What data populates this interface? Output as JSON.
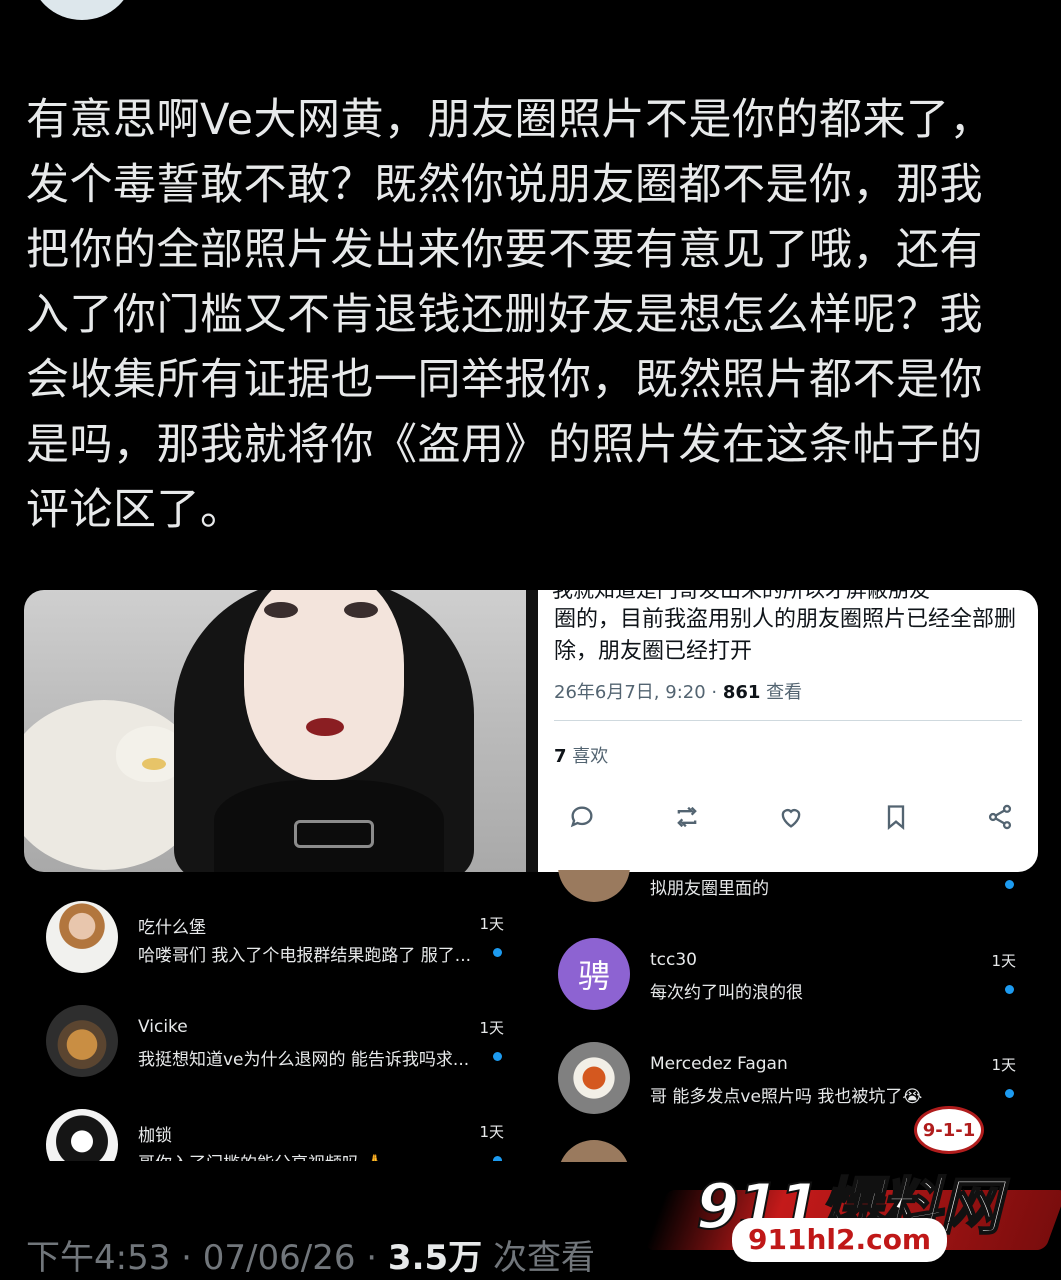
{
  "post": {
    "text": "有意思啊Ve大网黄，朋友圈照片不是你的都来了，发个毒誓敢不敢？既然你说朋友圈都不是你，那我把你的全部照片发出来你要不要有意见了哦，还有入了你门槛又不肯退钱还删好友是想怎么样呢？我会收集所有证据也一同举报你，既然照片都不是你是吗，那我就将你《盗用》的照片发在这条帖子的评论区了。",
    "time": "下午4:53 · 07/06/26 · ",
    "views_count": "3.5万",
    "views_label": " 次查看"
  },
  "embedded_tweet": {
    "cut_line": "我就知道是门哥发出来的所以才屏蔽朋友",
    "body": "圈的，目前我盗用别人的朋友圈照片已经全部删除，朋友圈已经打开",
    "date": "26年6月7日, 9:20 · ",
    "views_count": "861",
    "views_label": " 查看",
    "likes_count": "7",
    "likes_label": " 喜欢",
    "icons": [
      "reply-icon",
      "retweet-icon",
      "like-icon",
      "bookmark-icon",
      "share-icon"
    ]
  },
  "comments_left": [
    {
      "name": "吃什么堡",
      "text": "哈喽哥们 我入了个电报群结果跑路了 服了...",
      "time": "1天"
    },
    {
      "name": "Vicike",
      "text": "我挺想知道ve为什么退网的 能告诉我吗求...",
      "time": "1天"
    },
    {
      "name": "枷锁",
      "text": "哥你入了门槛的能分享视频吗 🙏",
      "time": "1天"
    }
  ],
  "comments_right": [
    {
      "name": "",
      "text": "拟朋友圈里面的",
      "time": ""
    },
    {
      "name": "tcc30",
      "text": "每次约了叫的浪的很",
      "time": "1天",
      "avatar_char": "骋"
    },
    {
      "name": "Mercedez Fagan",
      "text": "哥 能多发点ve照片吗 我也被坑了😭",
      "time": "1天"
    }
  ],
  "watermark": {
    "badge": "9-1-1",
    "brand": "911爆料网",
    "url": "911hl2.com"
  },
  "colors": {
    "background": "#000000",
    "text": "#e7e9ea",
    "muted": "#71767b",
    "accent": "#1d9bf0",
    "card": "#ffffff"
  }
}
